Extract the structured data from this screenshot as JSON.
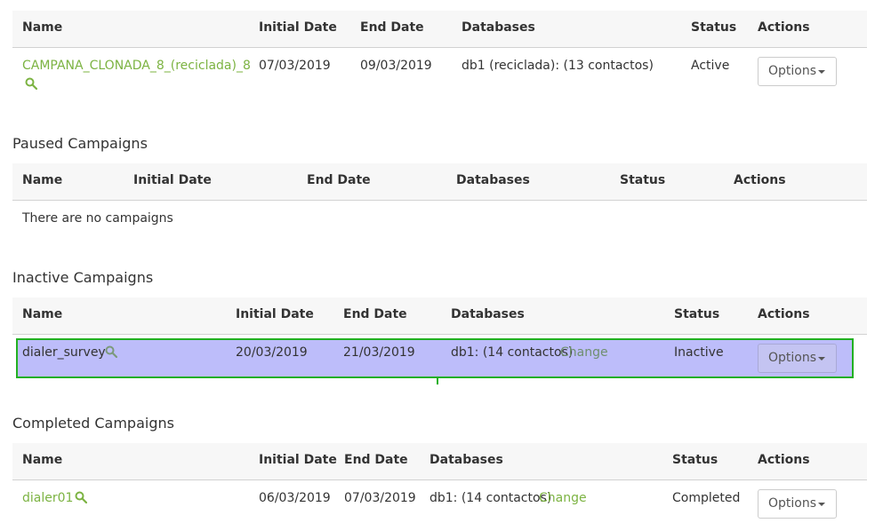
{
  "active": {
    "headers": {
      "name": "Name",
      "initial_date": "Initial Date",
      "end_date": "End Date",
      "databases": "Databases",
      "status": "Status",
      "actions": "Actions"
    },
    "rows": [
      {
        "name": "CAMPANA_CLONADA_8_(reciclada)_8",
        "initial_date": "07/03/2019",
        "end_date": "09/03/2019",
        "databases": "db1 (reciclada): (13 contactos)",
        "status": "Active",
        "action_label": "Options"
      }
    ]
  },
  "paused": {
    "title": "Paused Campaigns",
    "headers": {
      "name": "Name",
      "initial_date": "Initial Date",
      "end_date": "End Date",
      "databases": "Databases",
      "status": "Status",
      "actions": "Actions"
    },
    "empty_text": "There are no campaigns"
  },
  "inactive": {
    "title": "Inactive Campaigns",
    "headers": {
      "name": "Name",
      "initial_date": "Initial Date",
      "end_date": "End Date",
      "databases": "Databases",
      "status": "Status",
      "actions": "Actions"
    },
    "rows": [
      {
        "name": "dialer_survey",
        "initial_date": "20/03/2019",
        "end_date": "21/03/2019",
        "databases": "db1: (14 contactos)",
        "change_label": "Change",
        "status": "Inactive",
        "action_label": "Options"
      }
    ]
  },
  "completed": {
    "title": "Completed Campaigns",
    "headers": {
      "name": "Name",
      "initial_date": "Initial Date",
      "end_date": "End Date",
      "databases": "Databases",
      "status": "Status",
      "actions": "Actions"
    },
    "rows": [
      {
        "name": "dialer01",
        "initial_date": "06/03/2019",
        "end_date": "07/03/2019",
        "databases": "db1: (14 contactos)",
        "change_label": "Change",
        "status": "Completed",
        "action_label": "Options"
      }
    ]
  },
  "colors": {
    "link": "#7cb342",
    "highlight_fill": "#bdbdfa",
    "highlight_border": "#22b022",
    "header_bg": "#f7f7f7"
  },
  "icons": {
    "search": "search-icon",
    "caret": "caret-down-icon"
  }
}
